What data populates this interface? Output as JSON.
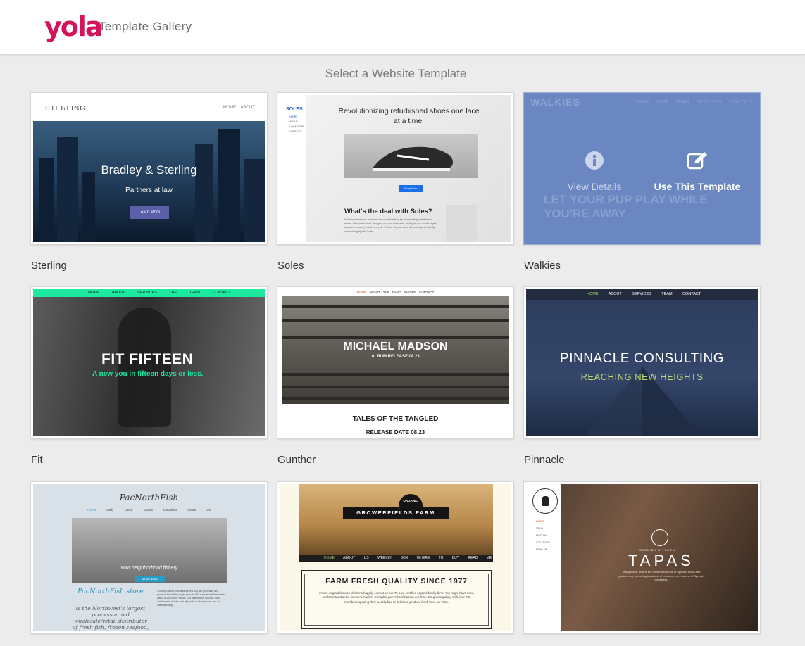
{
  "header": {
    "logo": "yola",
    "title": "Template Gallery"
  },
  "gallery": {
    "heading": "Select a Website Template"
  },
  "templates": {
    "sterling": {
      "label": "Sterling",
      "preview": {
        "brand": "STERLING",
        "nav": "HOME ABOUT",
        "title": "Bradley & Sterling",
        "subtitle": "Partners at law",
        "button": "Learn More"
      }
    },
    "soles": {
      "label": "Soles",
      "preview": {
        "brand": "SOLES",
        "nav": [
          "HOME",
          "ABOUT",
          "LOCATIONS",
          "CONTACT"
        ],
        "headline": "Revolutionizing refurbished shoes one lace at a time.",
        "button": "Shop Now",
        "question": "What's the deal with Soles?",
        "body": "Soles is working to re-shape the shoe industry by modernizing refurbished shoes. Here's the deal: You give us your old shoes, we'll give you credit to put toward a (nearly) brand new pair. C'mon, help us save the earth (and look fly while doing it) with Soles."
      }
    },
    "walkies": {
      "label": "Walkies",
      "preview": {
        "brand": "WALKIES",
        "nav": "HOME OUR TEAM SERVICES CONTACT",
        "tagline": "LET YOUR PUP PLAY WHILE YOU'RE AWAY"
      },
      "overlay": {
        "view_details": "View Details",
        "use_template": "Use This Template",
        "details_icon": "info-icon",
        "use_icon": "edit-icon"
      }
    },
    "fit": {
      "label": "Fit",
      "preview": {
        "nav": "HOME ABOUT SERVICES THE TEAM CONTACT",
        "title": "FIT FIFTEEN",
        "subtitle": "A new you in fifteen days or less."
      }
    },
    "gunther": {
      "label": "Gunther",
      "preview": {
        "nav_home": "HOME",
        "nav_rest": "ABOUT THE BAND SHOWS CONTACT",
        "title": "MICHAEL MADSON",
        "release": "ALBUM RELEASE 08.23",
        "section_title": "TALES OF THE TANGLED",
        "section_date": "RELEASE DATE 08.23"
      }
    },
    "pinnacle": {
      "label": "Pinnacle",
      "preview": {
        "nav_home": "HOME",
        "nav_rest": "ABOUT SERVICES TEAM CONTACT",
        "title": "PINNACLE CONSULTING",
        "subtitle": "REACHING NEW HEIGHTS"
      }
    },
    "pacnorthfish": {
      "label": "PacNorthFish",
      "preview": {
        "logo": "PacNorthFish",
        "nav_home": "Home",
        "nav_rest": "Daily Catch Goods Locations About Us",
        "caption": "Your neighborhood fishery",
        "pill": "since 1950",
        "name": "PacNorthFish store",
        "desc": "is the Northwest's largest processor and wholesale/retail distributor of fresh fish, frozen seafood, branded apparel and fishing accessories.",
        "body": "A family owned business since 1950, we purchase and process fresh fish caught by over 100 commercial fishermen within a 1,000 mile radius. Our distribution reaches from California to Alaska and all points in between, as well as internationally."
      }
    },
    "growerfields": {
      "label": "Growerfields",
      "preview": {
        "badge_top": "ORGANIC",
        "brand": "GROWERFIELDS FARM",
        "nav_home": "HOME",
        "nav_rest": "ABOUT US WEEKLY BOX WHERE TO BUY READ ME",
        "headline": "FARM FRESH QUALITY SINCE 1977",
        "body": "Fruits, vegetables and chickens happily coexist on our 75 acre certified organic family farm. You might have seen our farmstand at the farmer's market, or maybe you've heard about our CSA. It's growing daily, with over 200 members opening their weekly box to delicious produce fresh from our farm."
      }
    },
    "tapas": {
      "label": "Tapas",
      "preview": {
        "nav": [
          "ABOUT",
          "MENU",
          "HISTORY",
          "LOCATIONS",
          "READ ME"
        ],
        "tag": "SPANISH KITCHEN",
        "title": "TAPAS",
        "desc": "Mangiapane means the most marvellous of Spanish foods and gastronomy, preparing hundreds of products from dozens of Spanish producers."
      }
    }
  },
  "colors": {
    "brand": "#d4145a",
    "walkies_overlay": "#6a87c2",
    "fit_accent": "#1de99f",
    "pinnacle_accent": "#c2db73"
  }
}
